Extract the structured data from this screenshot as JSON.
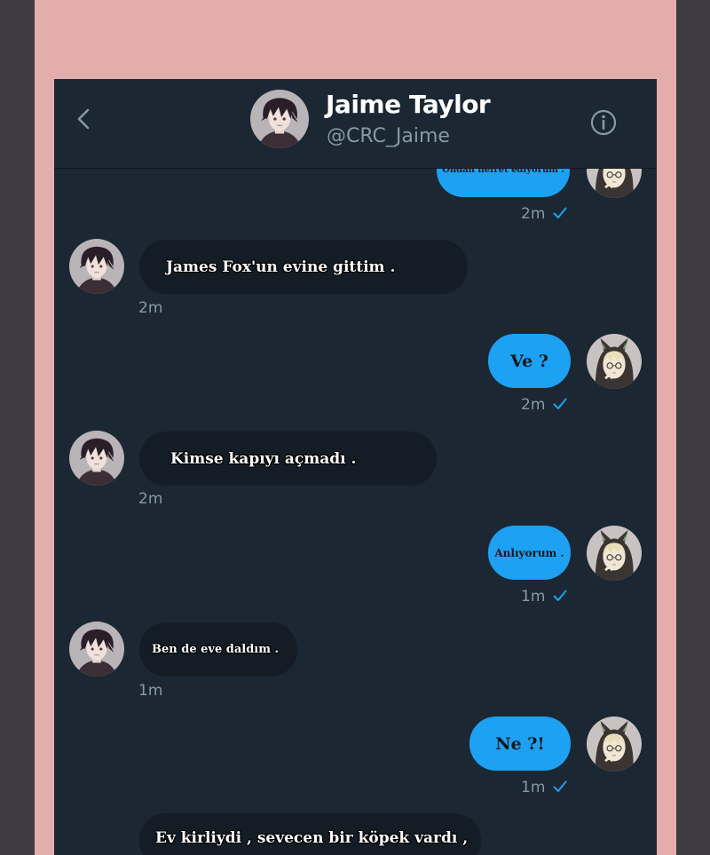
{
  "header": {
    "name": "Jaime Taylor",
    "handle": "@CRC_Jaime"
  },
  "messages": [
    {
      "side": "out",
      "text": "Ondan nefret ediyorum .",
      "time": "2m",
      "status": "sent"
    },
    {
      "side": "in",
      "text": "James Fox'un evine gittim .",
      "time": "2m"
    },
    {
      "side": "out",
      "text": "Ve ?",
      "time": "2m",
      "status": "sent"
    },
    {
      "side": "in",
      "text": "Kimse kapıyı açmadı .",
      "time": "2m"
    },
    {
      "side": "out",
      "text": "Anlıyorum .",
      "time": "1m",
      "status": "sent"
    },
    {
      "side": "in",
      "text": "Ben de eve daldım .",
      "time": "1m"
    },
    {
      "side": "out",
      "text": "Ne ?!",
      "time": "1m",
      "status": "sent"
    },
    {
      "side": "in",
      "text": "Ev kirliydi , sevecen bir köpek vardı ,"
    }
  ],
  "colors": {
    "page_border": "#e2adab",
    "background": "#1b2733",
    "outgoing_bubble": "#1da1f2",
    "incoming_bubble": "#141d26",
    "timestamp": "#8899a6"
  },
  "icons": {
    "back": "chevron-left-icon",
    "info": "info-circle-icon",
    "read_status": "check-icon"
  }
}
